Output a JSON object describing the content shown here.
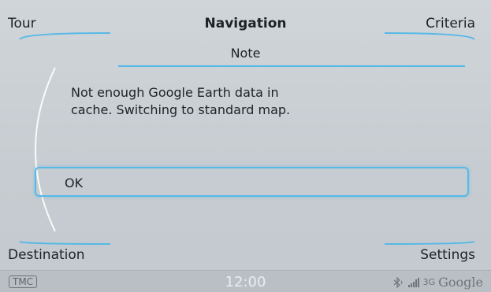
{
  "header": {
    "title": "Navigation",
    "left_softkey": "Tour",
    "right_softkey": "Criteria"
  },
  "dialog": {
    "subtitle": "Note",
    "message_line1": "Not enough Google Earth data in",
    "message_line2": "cache. Switching to standard map.",
    "ok_label": "OK"
  },
  "footer": {
    "left_softkey": "Destination",
    "right_softkey": "Settings"
  },
  "status_bar": {
    "tmc_label": "TMC",
    "clock": "12:00",
    "network_label": "3G",
    "brand": "Google",
    "icons": [
      "bluetooth-icon",
      "signal-strength-icon",
      "3g-icon"
    ]
  },
  "colors": {
    "accent": "#56b9e6",
    "background": "#c9cfd4",
    "text": "#1e2226"
  }
}
